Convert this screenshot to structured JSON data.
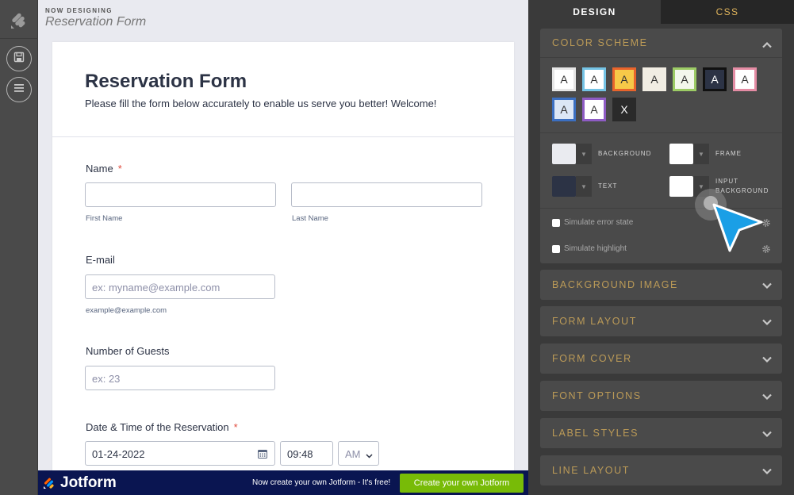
{
  "header": {
    "kicker": "NOW DESIGNING",
    "title": "Reservation Form"
  },
  "form": {
    "title": "Reservation Form",
    "subtitle": "Please fill the form below accurately to enable us serve you better! Welcome!",
    "name_label": "Name",
    "required_mark": "*",
    "first_name_sub": "First Name",
    "last_name_sub": "Last Name",
    "email_label": "E-mail",
    "email_placeholder": "ex: myname@example.com",
    "email_sub": "example@example.com",
    "guests_label": "Number of Guests",
    "guests_placeholder": "ex: 23",
    "datetime_label": "Date & Time of the Reservation",
    "date_value": "01-24-2022",
    "time_value": "09:48",
    "ampm_value": "AM"
  },
  "footer": {
    "brand": "Jotform",
    "promo": "Now create your own Jotform - It's free!",
    "cta": "Create your own Jotform"
  },
  "panel": {
    "tabs": [
      "DESIGN",
      "CSS"
    ],
    "color_scheme_title": "COLOR SCHEME",
    "swatches": [
      {
        "label": "A",
        "bg": "#ffffff",
        "border": "#e6e6e6",
        "fg": "#333333"
      },
      {
        "label": "A",
        "bg": "#ffffff",
        "border": "#74c3e5",
        "fg": "#333333"
      },
      {
        "label": "A",
        "bg": "#f7c948",
        "border": "#e8642c",
        "fg": "#333333"
      },
      {
        "label": "A",
        "bg": "#f1ede3",
        "border": "#f1ede3",
        "fg": "#333333"
      },
      {
        "label": "A",
        "bg": "#f3f7ec",
        "border": "#9ccb65",
        "fg": "#333333"
      },
      {
        "label": "A",
        "bg": "#2c3345",
        "border": "#111111",
        "fg": "#ffffff"
      },
      {
        "label": "A",
        "bg": "#ffffff",
        "border": "#e48ca4",
        "fg": "#333333"
      },
      {
        "label": "A",
        "bg": "#dce7f6",
        "border": "#3b6fc1",
        "fg": "#333333"
      },
      {
        "label": "A",
        "bg": "#ffffff",
        "border": "#8e5cc4",
        "fg": "#333333"
      },
      {
        "label": "X",
        "bg": "#2a2a2a",
        "border": "#2a2a2a",
        "fg": "#ffffff"
      }
    ],
    "colors": {
      "background_label": "BACKGROUND",
      "background_color": "#eaebf0",
      "frame_label": "FRAME",
      "frame_color": "#ffffff",
      "text_label": "TEXT",
      "text_color": "#2c3345",
      "input_bg_label": "INPUT BACKGROUND",
      "input_bg_color": "#ffffff"
    },
    "simulate_error": "Simulate error state",
    "simulate_highlight": "Simulate highlight",
    "sections": [
      "BACKGROUND IMAGE",
      "FORM LAYOUT",
      "FORM COVER",
      "FONT OPTIONS",
      "LABEL STYLES",
      "LINE LAYOUT"
    ]
  }
}
